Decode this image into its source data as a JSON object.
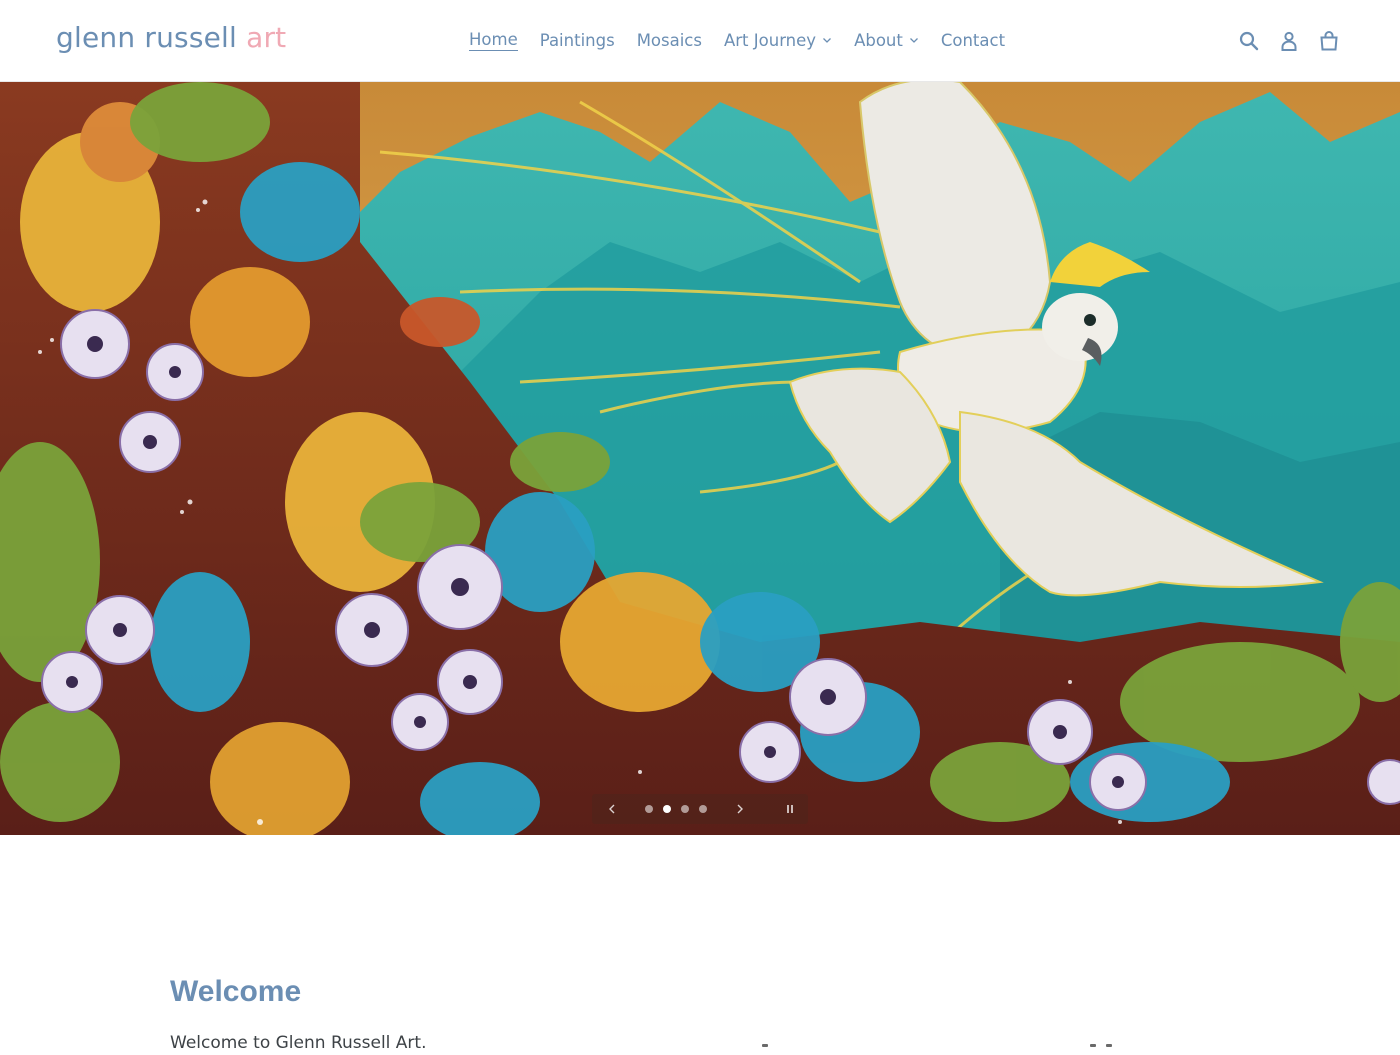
{
  "header": {
    "logo": {
      "part1": "glenn russell",
      "part2": "art"
    },
    "nav": [
      {
        "label": "Home",
        "active": true,
        "dropdown": false
      },
      {
        "label": "Paintings",
        "active": false,
        "dropdown": false
      },
      {
        "label": "Mosaics",
        "active": false,
        "dropdown": false
      },
      {
        "label": "Art Journey",
        "active": false,
        "dropdown": true
      },
      {
        "label": "About",
        "active": false,
        "dropdown": true
      },
      {
        "label": "Contact",
        "active": false,
        "dropdown": false
      }
    ],
    "icons": [
      "search-icon",
      "account-icon",
      "cart-icon"
    ]
  },
  "hero": {
    "slideshow": {
      "slide_count": 4,
      "active_slide": 2
    },
    "controls": [
      "chevron-left-icon",
      "chevron-right-icon",
      "pause-icon"
    ]
  },
  "welcome": {
    "title": "Welcome",
    "text": "Welcome to Glenn Russell Art."
  },
  "colors": {
    "accent": "#6b8eb3",
    "logo_pink": "#f0a9b4",
    "body_text": "#3d4246"
  }
}
